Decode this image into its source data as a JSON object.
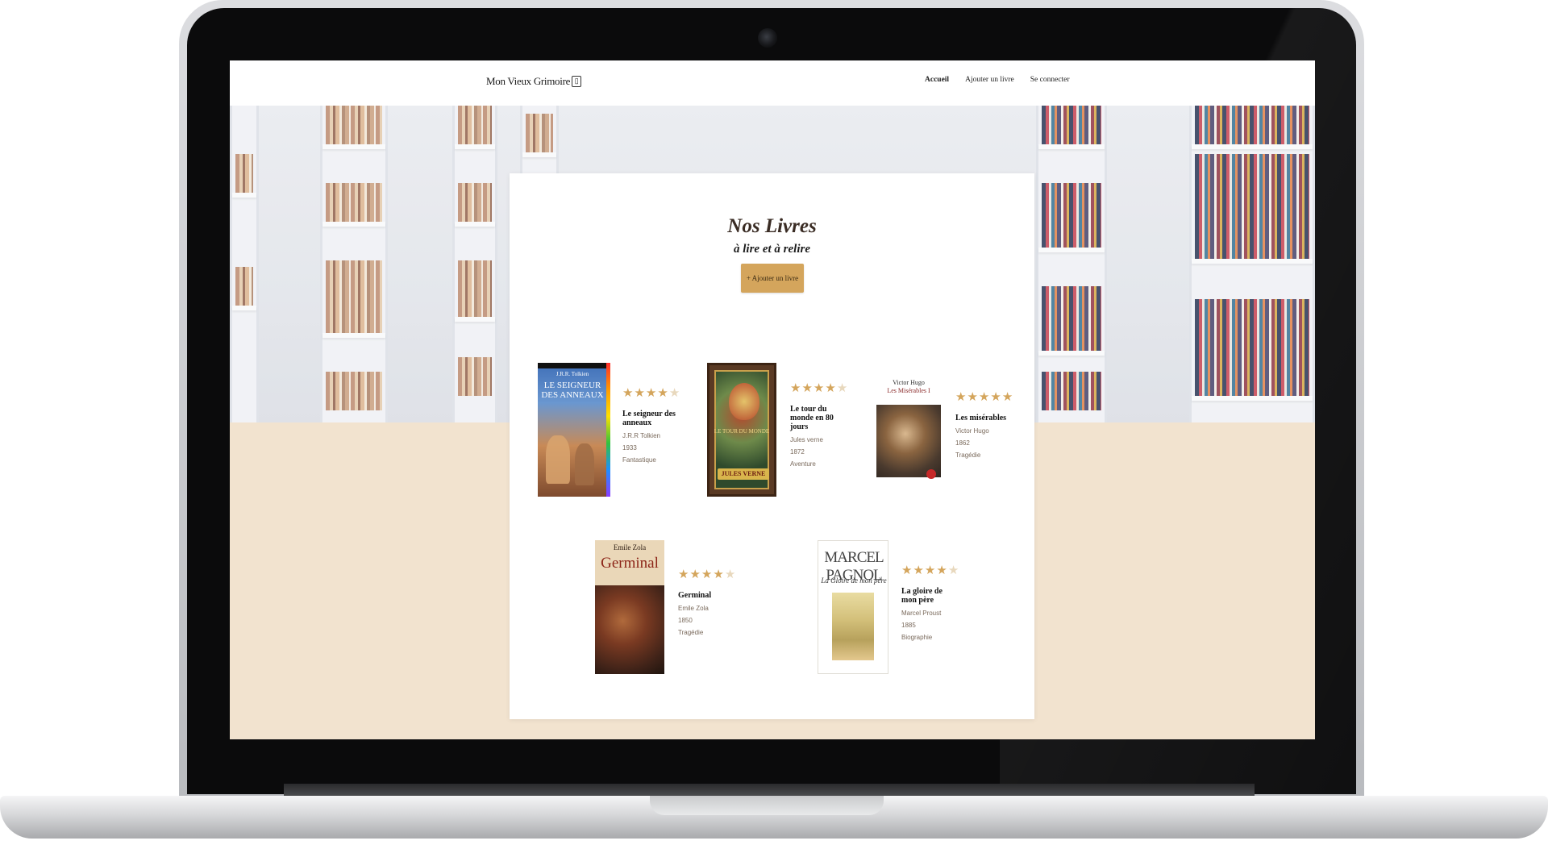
{
  "brand": {
    "name": "Mon Vieux Grimoire",
    "icon": "book-icon"
  },
  "nav": {
    "items": [
      {
        "label": "Accueil",
        "active": true
      },
      {
        "label": "Ajouter un livre",
        "active": false
      },
      {
        "label": "Se connecter",
        "active": false
      }
    ]
  },
  "main": {
    "title": "Nos Livres",
    "subtitle": "à lire et à relire",
    "add_button_label": "+ Ajouter un livre"
  },
  "books": [
    {
      "title": "Le seigneur des anneaux",
      "author": "J.R.R Tolkien",
      "year": "1933",
      "genre": "Fantastique",
      "rating": 4,
      "cover_text": {
        "author": "J.R.R. Tolkien",
        "title": "LE SEIGNEUR DES ANNEAUX"
      }
    },
    {
      "title": "Le tour du monde en 80 jours",
      "author": "Jules verne",
      "year": "1872",
      "genre": "Aventure",
      "rating": 4,
      "cover_text": {
        "title": "LE TOUR DU MONDE",
        "author": "JULES VERNE"
      }
    },
    {
      "title": "Les misérables",
      "author": "Victor Hugo",
      "year": "1862",
      "genre": "Tragédie",
      "rating": 5,
      "cover_text": {
        "author": "Victor Hugo",
        "title": "Les Misérables I"
      }
    },
    {
      "title": "Germinal",
      "author": "Emile Zola",
      "year": "1850",
      "genre": "Tragédie",
      "rating": 4,
      "cover_text": {
        "author": "Emile Zola",
        "title": "Germinal"
      }
    },
    {
      "title": "La gloire de mon père",
      "author": "Marcel Proust",
      "year": "1885",
      "genre": "Biographie",
      "rating": 4,
      "cover_text": {
        "author": "MARCEL PAGNOL",
        "title": "La Gloire de mon père"
      }
    }
  ],
  "colors": {
    "accent": "#d4a55c",
    "background": "#f2e3cf",
    "star_empty": "#e8d8bd"
  }
}
